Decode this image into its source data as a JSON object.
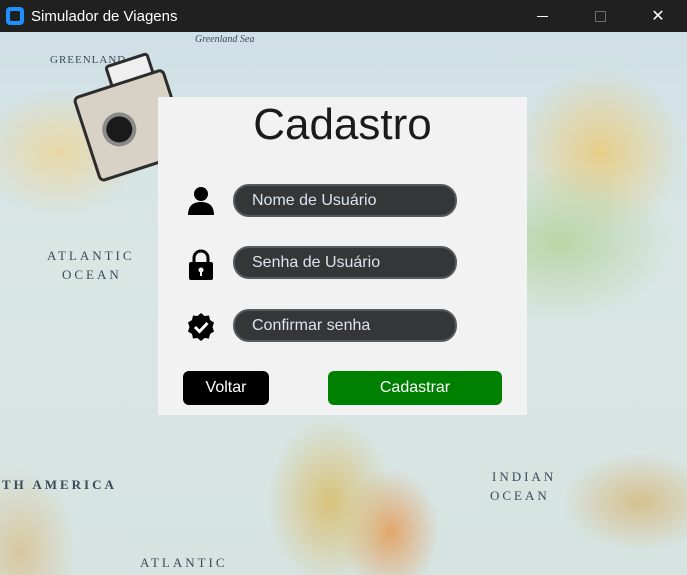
{
  "window": {
    "title": "Simulador de Viagens",
    "controls": {
      "minimize": "minimize",
      "maximize": "maximize",
      "close": "✕"
    }
  },
  "map_labels": {
    "greenland": "GREENLAND",
    "greenland_sea": "Greenland Sea",
    "atlantic_ocean_1": "ATLANTIC",
    "atlantic_ocean_2": "OCEAN",
    "indian_ocean_1": "INDIAN",
    "indian_ocean_2": "OCEAN",
    "south_america": "TH AMERICA",
    "atlantic_bottom": "ATLANTIC"
  },
  "form": {
    "title": "Cadastro",
    "username_placeholder": "Nome de Usuário",
    "password_placeholder": "Senha de Usuário",
    "confirm_placeholder": "Confirmar senha",
    "back_label": "Voltar",
    "register_label": "Cadastrar"
  },
  "icons": {
    "user": "user-icon",
    "lock": "lock-icon",
    "check": "verified-check-icon"
  },
  "colors": {
    "field_bg": "#343638",
    "field_border": "#565b5e",
    "back_button": "#000000",
    "register_button": "#008000",
    "card_bg": "#f2f2f2"
  }
}
